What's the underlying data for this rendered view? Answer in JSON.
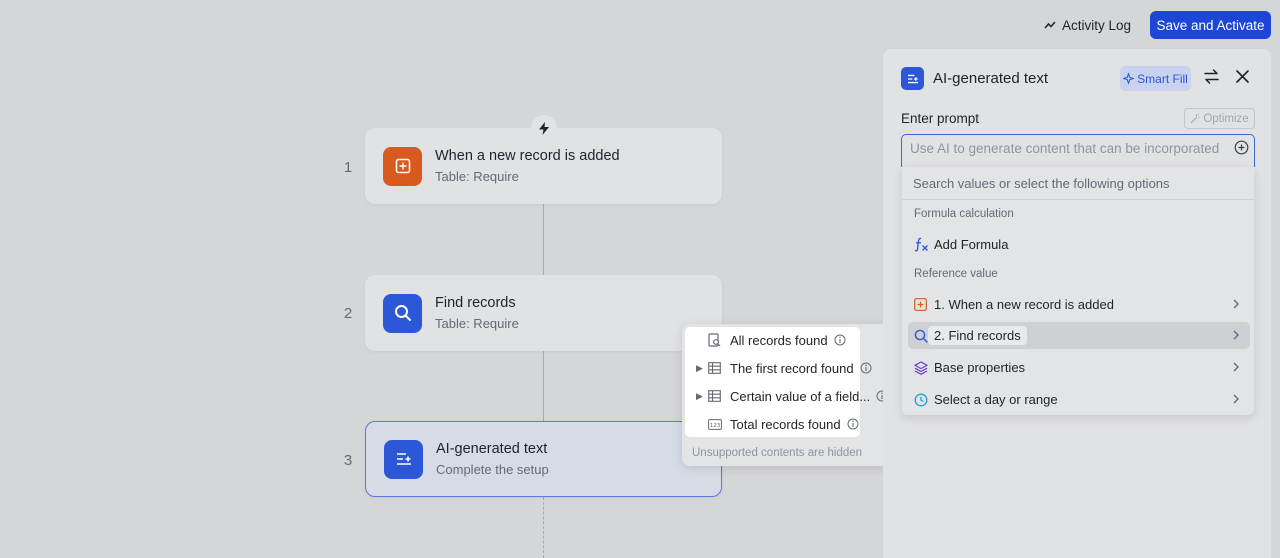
{
  "topbar": {
    "activity_log": "Activity Log",
    "save_activate": "Save and Activate"
  },
  "workflow": {
    "steps": [
      {
        "num": "1",
        "title": "When a new record is added",
        "subtitle": "Table: Require",
        "icon": "add-record-icon",
        "color": "#d85a1f"
      },
      {
        "num": "2",
        "title": "Find records",
        "subtitle": "Table: Require",
        "icon": "search-icon",
        "color": "#2c58d8"
      },
      {
        "num": "3",
        "title": "AI-generated text",
        "subtitle": "Complete the setup",
        "icon": "ai-text-icon",
        "color": "#2c58d8"
      }
    ]
  },
  "submenu": {
    "items": [
      {
        "label": "All records found",
        "icon": "records-search-icon",
        "expandable": false
      },
      {
        "label": "The first record found",
        "icon": "table-icon",
        "expandable": true
      },
      {
        "label": "Certain value of a field...",
        "icon": "table-icon",
        "expandable": true
      },
      {
        "label": "Total records found",
        "icon": "number-icon",
        "expandable": false
      }
    ],
    "hint": "Unsupported contents are hidden"
  },
  "panel": {
    "title": "AI-generated text",
    "smart_fill": "Smart Fill",
    "prompt_label": "Enter prompt",
    "optimize": "Optimize",
    "prompt_placeholder": "Use AI to generate content that can be incorporated"
  },
  "dropdown": {
    "search_placeholder": "Search values or select the following options",
    "group_formula": "Formula calculation",
    "add_formula": "Add Formula",
    "group_reference": "Reference value",
    "items": [
      {
        "label": "1. When a new record is added",
        "icon": "add-record-icon"
      },
      {
        "label": "2. Find records",
        "icon": "search-icon"
      },
      {
        "label": "Base properties",
        "icon": "layers-icon"
      },
      {
        "label": "Select a day or range",
        "icon": "clock-icon"
      }
    ]
  },
  "colors": {
    "accent": "#1d46d6",
    "trigger": "#d85a1f",
    "base_properties": "#6b3fd1",
    "date": "#1ba0d8"
  }
}
